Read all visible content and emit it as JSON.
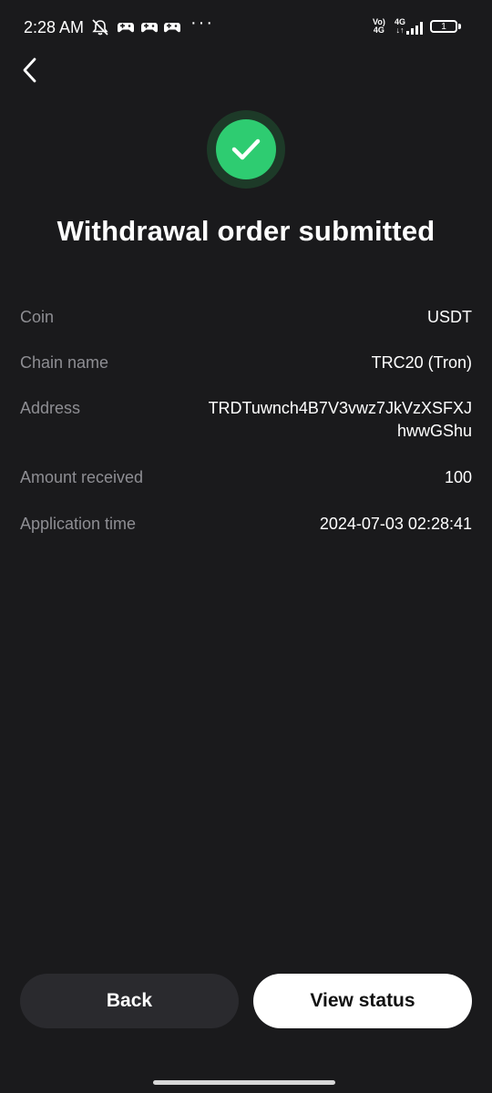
{
  "status_bar": {
    "time": "2:28 AM",
    "dots": "···",
    "volte_top": "Vo)",
    "volte_bottom": "4G",
    "net_top": "4G",
    "net_bottom": "↓↑",
    "battery": "1",
    "icons": [
      "mute-icon",
      "game-controller-icon",
      "game-controller-icon",
      "game-controller-icon",
      "signal-icon",
      "battery-icon"
    ]
  },
  "header": {
    "back_icon": "chevron-left-icon"
  },
  "result": {
    "icon": "check-circle-icon",
    "title": "Withdrawal order submitted",
    "accent_color": "#2ecc71"
  },
  "details": [
    {
      "label": "Coin",
      "value": "USDT"
    },
    {
      "label": "Chain name",
      "value": "TRC20 (Tron)"
    },
    {
      "label": "Address",
      "value": "TRDTuwnch4B7V3vwz7JkVzXSFXJhwwGShu"
    },
    {
      "label": "Amount received",
      "value": "100"
    },
    {
      "label": "Application time",
      "value": "2024-07-03 02:28:41"
    }
  ],
  "actions": {
    "back_label": "Back",
    "view_status_label": "View status"
  }
}
